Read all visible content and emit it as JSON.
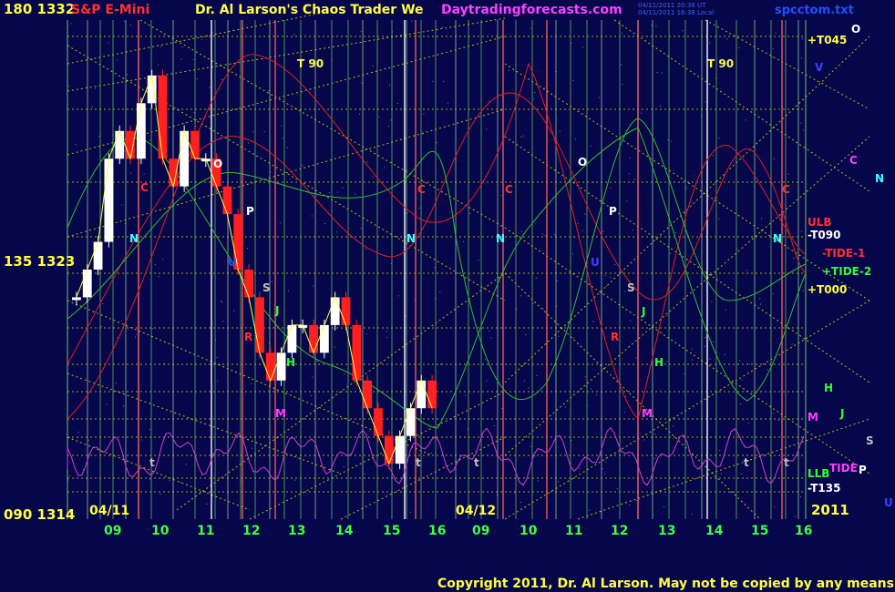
{
  "header": {
    "left_price_label": "180 1332",
    "instrument": "S&P E-Mini",
    "title": "Dr. Al Larson's Chaos Trader We",
    "website": "Daytradingforecasts.com",
    "timestamp_1": "04/11/2011 20:38 UT",
    "timestamp_2": "04/11/2011 16:38 Local",
    "filename": "spcctom.txt"
  },
  "footer": {
    "copyright": "Copyright 2011, Dr. Al Larson. May not be copied by any means."
  },
  "colors": {
    "background": "#06064a",
    "grid_green": "#6ec86e",
    "grid_yellow": "#e8e800",
    "red_line": "#e02020",
    "green_line": "#30c030",
    "magenta_line": "#d040d0",
    "candle_up": "#ffffff",
    "candle_down": "#ff2020"
  },
  "chart_data": {
    "type": "line",
    "y_axis_labels": [
      {
        "text": "180 1332",
        "value": 1332
      },
      {
        "text": "135 1323",
        "value": 1323
      },
      {
        "text": "090 1314",
        "value": 1314
      }
    ],
    "ylim": [
      1314,
      1332
    ],
    "date_labels": [
      "04/11",
      "04/12",
      "2011"
    ],
    "x_tick_labels": [
      "09",
      "10",
      "11",
      "12",
      "13",
      "14",
      "15",
      "16",
      "09",
      "10",
      "11",
      "12",
      "13",
      "14",
      "15",
      "16"
    ],
    "price_series_approx": [
      1322,
      1323,
      1324,
      1327,
      1328,
      1327,
      1329,
      1330,
      1327,
      1326,
      1328,
      1327,
      1327,
      1326,
      1325,
      1323,
      1322,
      1320,
      1319,
      1320,
      1321,
      1321,
      1320,
      1321,
      1322,
      1321,
      1319,
      1318,
      1317,
      1316,
      1317,
      1318,
      1319,
      1318
    ],
    "right_labels": [
      {
        "text": "+T045",
        "color": "#ffff40"
      },
      {
        "text": "O",
        "color": "#ffffff"
      },
      {
        "text": "V",
        "color": "#4040ff"
      },
      {
        "text": "C",
        "color": "#ff40ff"
      },
      {
        "text": "N",
        "color": "#40ffff"
      },
      {
        "text": "ULB",
        "color": "#ff3030"
      },
      {
        "text": "-T090",
        "color": "#ffffff"
      },
      {
        "text": "-TIDE-1",
        "color": "#ff3030"
      },
      {
        "text": "+TIDE-2",
        "color": "#30ff30"
      },
      {
        "text": "+T000",
        "color": "#ffff40"
      },
      {
        "text": "H",
        "color": "#30ff30"
      },
      {
        "text": "J",
        "color": "#30ff30"
      },
      {
        "text": "M",
        "color": "#ff40ff"
      },
      {
        "text": "S",
        "color": "#c0c0c0"
      },
      {
        "text": "LLB",
        "color": "#30ff30"
      },
      {
        "text": "TIDE",
        "color": "#ff40ff"
      },
      {
        "text": "P",
        "color": "#ffffff"
      },
      {
        "text": "-T135",
        "color": "#ffffff"
      },
      {
        "text": "U",
        "color": "#4040ff"
      }
    ],
    "in_chart_labels": [
      {
        "text": "T  90",
        "color": "#ffff40"
      },
      {
        "text": "T  90",
        "color": "#ffff40"
      },
      {
        "text": "N",
        "color": "#40ffff"
      },
      {
        "text": "C",
        "color": "#ff3030"
      },
      {
        "text": "P",
        "color": "#ffffff"
      },
      {
        "text": "O",
        "color": "#ffffff"
      },
      {
        "text": "U",
        "color": "#4040ff"
      },
      {
        "text": "S",
        "color": "#c0c0c0"
      },
      {
        "text": "R",
        "color": "#ff3030"
      },
      {
        "text": "J",
        "color": "#30ff30"
      },
      {
        "text": "H",
        "color": "#30ff30"
      },
      {
        "text": "M",
        "color": "#ff40ff"
      },
      {
        "text": "t",
        "color": "#c0c0c0"
      },
      {
        "text": "N",
        "color": "#40ffff"
      },
      {
        "text": "C",
        "color": "#ff3030"
      },
      {
        "text": "N",
        "color": "#40ffff"
      },
      {
        "text": "C",
        "color": "#ff3030"
      },
      {
        "text": "O",
        "color": "#ffffff"
      },
      {
        "text": "P",
        "color": "#ffffff"
      },
      {
        "text": "U",
        "color": "#4040ff"
      },
      {
        "text": "S",
        "color": "#c0c0c0"
      },
      {
        "text": "J",
        "color": "#30ff30"
      },
      {
        "text": "R",
        "color": "#ff3030"
      },
      {
        "text": "H",
        "color": "#30ff30"
      },
      {
        "text": "M",
        "color": "#ff40ff"
      },
      {
        "text": "t",
        "color": "#c0c0c0"
      },
      {
        "text": "t",
        "color": "#c0c0c0"
      },
      {
        "text": "N",
        "color": "#40ffff"
      },
      {
        "text": "C",
        "color": "#ff3030"
      },
      {
        "text": "t",
        "color": "#c0c0c0"
      },
      {
        "text": "t",
        "color": "#c0c0c0"
      }
    ]
  }
}
